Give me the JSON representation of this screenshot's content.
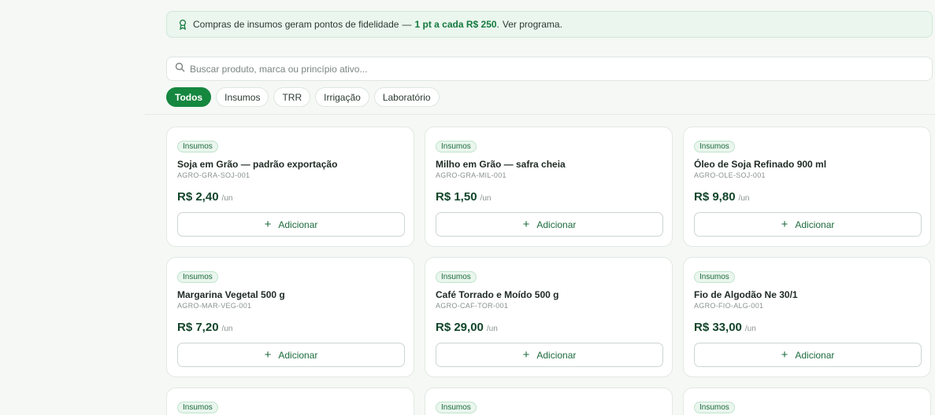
{
  "banner": {
    "text": "Compras de insumos geram pontos de fidelidade",
    "separator": "—",
    "highlight": "1 pt a cada R$ 250",
    "link": "Ver programa."
  },
  "search": {
    "placeholder": "Buscar produto, marca ou princípio ativo...",
    "value": ""
  },
  "chips": [
    {
      "label": "Todos",
      "active": true
    },
    {
      "label": "Insumos",
      "active": false
    },
    {
      "label": "TRR",
      "active": false
    },
    {
      "label": "Irrigação",
      "active": false
    },
    {
      "label": "Laboratório",
      "active": false
    }
  ],
  "products": [
    {
      "badge": "Insumos",
      "name": "Soja em Grão — padrão exportação",
      "sku": "AGRO-GRA-SOJ-001",
      "price": "R$ 2,40",
      "unit": "/un",
      "add_label": "Adicionar"
    },
    {
      "badge": "Insumos",
      "name": "Milho em Grão — safra cheia",
      "sku": "AGRO-GRA-MIL-001",
      "price": "R$ 1,50",
      "unit": "/un",
      "add_label": "Adicionar"
    },
    {
      "badge": "Insumos",
      "name": "Óleo de Soja Refinado 900 ml",
      "sku": "AGRO-OLE-SOJ-001",
      "price": "R$ 9,80",
      "unit": "/un",
      "add_label": "Adicionar"
    },
    {
      "badge": "Insumos",
      "name": "Margarina Vegetal 500 g",
      "sku": "AGRO-MAR-VEG-001",
      "price": "R$ 7,20",
      "unit": "/un",
      "add_label": "Adicionar"
    },
    {
      "badge": "Insumos",
      "name": "Café Torrado e Moído 500 g",
      "sku": "AGRO-CAF-TOR-001",
      "price": "R$ 29,00",
      "unit": "/un",
      "add_label": "Adicionar"
    },
    {
      "badge": "Insumos",
      "name": "Fio de Algodão Ne 30/1",
      "sku": "AGRO-FIO-ALG-001",
      "price": "R$ 33,00",
      "unit": "/un",
      "add_label": "Adicionar"
    }
  ],
  "partial_badges": [
    "Insumos",
    "Insumos",
    "Insumos"
  ],
  "colors": {
    "accent": "#15873f",
    "price": "#12452a",
    "badge_bg": "#eaf6ee"
  },
  "icons": {
    "banner": "award-icon",
    "search": "search-icon",
    "add": "plus-icon"
  }
}
